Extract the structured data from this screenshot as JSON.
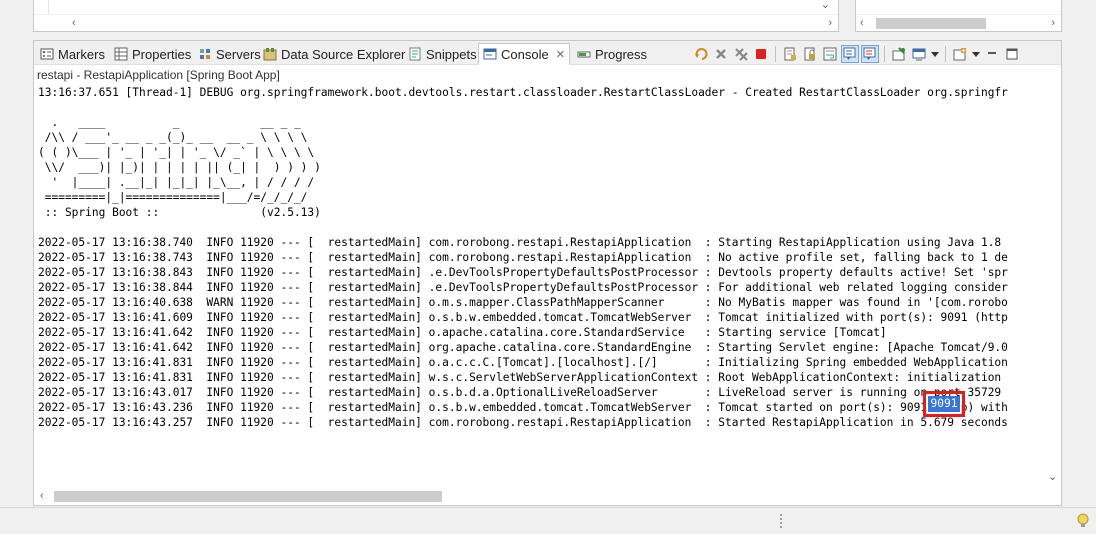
{
  "tabs": [
    {
      "label": "Markers",
      "icon": "markers-icon",
      "active": false
    },
    {
      "label": "Properties",
      "icon": "properties-icon",
      "active": false
    },
    {
      "label": "Servers",
      "icon": "servers-icon",
      "active": false
    },
    {
      "label": "Data Source Explorer",
      "icon": "data-source-icon",
      "active": false
    },
    {
      "label": "Snippets",
      "icon": "snippets-icon",
      "active": false
    },
    {
      "label": "Console",
      "icon": "console-icon",
      "active": true
    },
    {
      "label": "Progress",
      "icon": "progress-icon",
      "active": false
    }
  ],
  "toolbar_icons": [
    "terminate-relaunch-icon",
    "remove-launch-icon",
    "remove-all-terminated-icon",
    "terminate-icon",
    "clear-console-icon",
    "scroll-lock-icon",
    "word-wrap-icon",
    "show-on-stdout-icon",
    "show-on-stderr-icon",
    "pin-console-icon",
    "display-console-icon",
    "open-console-icon",
    "minimize-icon",
    "maximize-icon"
  ],
  "process_label": "restapi - RestapiApplication [Spring Boot App]",
  "console_lines": [
    "13:16:37.651 [Thread-1] DEBUG org.springframework.boot.devtools.restart.classloader.RestartClassLoader - Created RestartClassLoader org.springfr",
    "",
    "  .   ____          _            __ _ _",
    " /\\\\ / ___'_ __ _ _(_)_ __  __ _ \\ \\ \\ \\",
    "( ( )\\___ | '_ | '_| | '_ \\/ _` | \\ \\ \\ \\",
    " \\\\/  ___)| |_)| | | | | || (_| |  ) ) ) )",
    "  '  |____| .__|_| |_|_| |_\\__, | / / / /",
    " =========|_|==============|___/=/_/_/_/",
    " :: Spring Boot ::               (v2.5.13)",
    "",
    "2022-05-17 13:16:38.740  INFO 11920 --- [  restartedMain] com.rorobong.restapi.RestapiApplication  : Starting RestapiApplication using Java 1.8",
    "2022-05-17 13:16:38.743  INFO 11920 --- [  restartedMain] com.rorobong.restapi.RestapiApplication  : No active profile set, falling back to 1 de",
    "2022-05-17 13:16:38.843  INFO 11920 --- [  restartedMain] .e.DevToolsPropertyDefaultsPostProcessor : Devtools property defaults active! Set 'spr",
    "2022-05-17 13:16:38.844  INFO 11920 --- [  restartedMain] .e.DevToolsPropertyDefaultsPostProcessor : For additional web related logging consider",
    "2022-05-17 13:16:40.638  WARN 11920 --- [  restartedMain] o.m.s.mapper.ClassPathMapperScanner      : No MyBatis mapper was found in '[com.rorobo",
    "2022-05-17 13:16:41.609  INFO 11920 --- [  restartedMain] o.s.b.w.embedded.tomcat.TomcatWebServer  : Tomcat initialized with port(s): 9091 (http",
    "2022-05-17 13:16:41.642  INFO 11920 --- [  restartedMain] o.apache.catalina.core.StandardService   : Starting service [Tomcat]",
    "2022-05-17 13:16:41.642  INFO 11920 --- [  restartedMain] org.apache.catalina.core.StandardEngine  : Starting Servlet engine: [Apache Tomcat/9.0",
    "2022-05-17 13:16:41.831  INFO 11920 --- [  restartedMain] o.a.c.c.C.[Tomcat].[localhost].[/]       : Initializing Spring embedded WebApplication",
    "2022-05-17 13:16:41.831  INFO 11920 --- [  restartedMain] w.s.c.ServletWebServerApplicationContext : Root WebApplicationContext: initialization",
    "2022-05-17 13:16:43.017  INFO 11920 --- [  restartedMain] o.s.b.d.a.OptionalLiveReloadServer       : LiveReload server is running on port 35729",
    "2022-05-17 13:16:43.236  INFO 11920 --- [  restartedMain] o.s.b.w.embedded.tomcat.TomcatWebServer  : Tomcat started on port(s): 9091 (http) with",
    "2022-05-17 13:16:43.257  INFO 11920 --- [  restartedMain] com.rorobong.restapi.RestapiApplication  : Started RestapiApplication in 5.679 seconds"
  ],
  "selected_text": "9091",
  "colors": {
    "selection": "#3875d7",
    "annotation": "#e21b1b",
    "terminate": "#e02020"
  }
}
